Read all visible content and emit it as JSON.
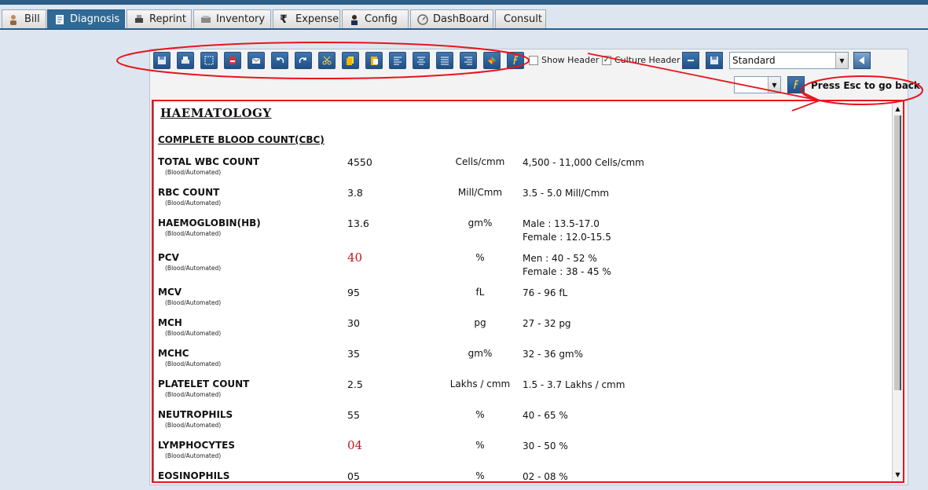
{
  "tabs": [
    {
      "label": "Bill",
      "icon": "user-icon",
      "active": false
    },
    {
      "label": "Diagnosis",
      "icon": "notepad-icon",
      "active": true
    },
    {
      "label": "Reprint",
      "icon": "printer-icon",
      "active": false
    },
    {
      "label": "Inventory",
      "icon": "inventory-icon",
      "active": false
    },
    {
      "label": "Expense",
      "icon": "rupee-icon",
      "active": false
    },
    {
      "label": "Config",
      "icon": "person-icon",
      "active": false
    },
    {
      "label": "DashBoard",
      "icon": "gauge-icon",
      "active": false
    },
    {
      "label": "Consult",
      "icon": "",
      "active": false
    }
  ],
  "toolbar": {
    "show_header_label": "Show Header",
    "show_header_checked": false,
    "culture_header_label": "Culture Header",
    "culture_header_checked": true,
    "template_select": "Standard",
    "size_select": "",
    "esc_hint": "Press Esc to go back"
  },
  "report": {
    "section_title": "HAEMATOLOGY",
    "subsection_title": "COMPLETE BLOOD COUNT(CBC)",
    "rows": [
      {
        "name": "TOTAL WBC COUNT",
        "method": "(Blood/Automated)",
        "value": "4550",
        "abnormal": false,
        "unit": "Cells/cmm",
        "range": [
          "4,500 - 11,000 Cells/cmm"
        ]
      },
      {
        "name": "RBC COUNT",
        "method": "(Blood/Automated)",
        "value": "3.8",
        "abnormal": false,
        "unit": "Mill/Cmm",
        "range": [
          "3.5 - 5.0 Mill/Cmm"
        ]
      },
      {
        "name": "HAEMOGLOBIN(HB)",
        "method": "(Blood/Automated)",
        "value": "13.6",
        "abnormal": false,
        "unit": "gm%",
        "range": [
          "Male : 13.5-17.0",
          "Female : 12.0-15.5"
        ]
      },
      {
        "name": "PCV",
        "method": "(Blood/Automated)",
        "value": "40",
        "abnormal": true,
        "unit": "%",
        "range": [
          "Men : 40 - 52 %",
          "Female : 38 - 45 %"
        ]
      },
      {
        "name": "MCV",
        "method": "(Blood/Automated)",
        "value": "95",
        "abnormal": false,
        "unit": "fL",
        "range": [
          "76 - 96 fL"
        ]
      },
      {
        "name": "MCH",
        "method": "(Blood/Automated)",
        "value": "30",
        "abnormal": false,
        "unit": "pg",
        "range": [
          "27 - 32 pg"
        ]
      },
      {
        "name": "MCHC",
        "method": "(Blood/Automated)",
        "value": "35",
        "abnormal": false,
        "unit": "gm%",
        "range": [
          "32 - 36 gm%"
        ]
      },
      {
        "name": "PLATELET COUNT",
        "method": "(Blood/Automated)",
        "value": "2.5",
        "abnormal": false,
        "unit": "Lakhs / cmm",
        "range": [
          "1.5 - 3.7 Lakhs / cmm"
        ]
      },
      {
        "name": "NEUTROPHILS",
        "method": "(Blood/Automated)",
        "value": "55",
        "abnormal": false,
        "unit": "%",
        "range": [
          "40 - 65 %"
        ]
      },
      {
        "name": "LYMPHOCYTES",
        "method": "(Blood/Automated)",
        "value": "04",
        "abnormal": true,
        "unit": "%",
        "range": [
          "30 - 50 %"
        ]
      },
      {
        "name": "EOSINOPHILS",
        "method": "",
        "value": "05",
        "abnormal": false,
        "unit": "%",
        "range": [
          "02 - 08 %"
        ]
      }
    ]
  },
  "colors": {
    "accent": "#2b5d86",
    "abnormal": "#c0161b",
    "annotation": "#e8141c"
  }
}
